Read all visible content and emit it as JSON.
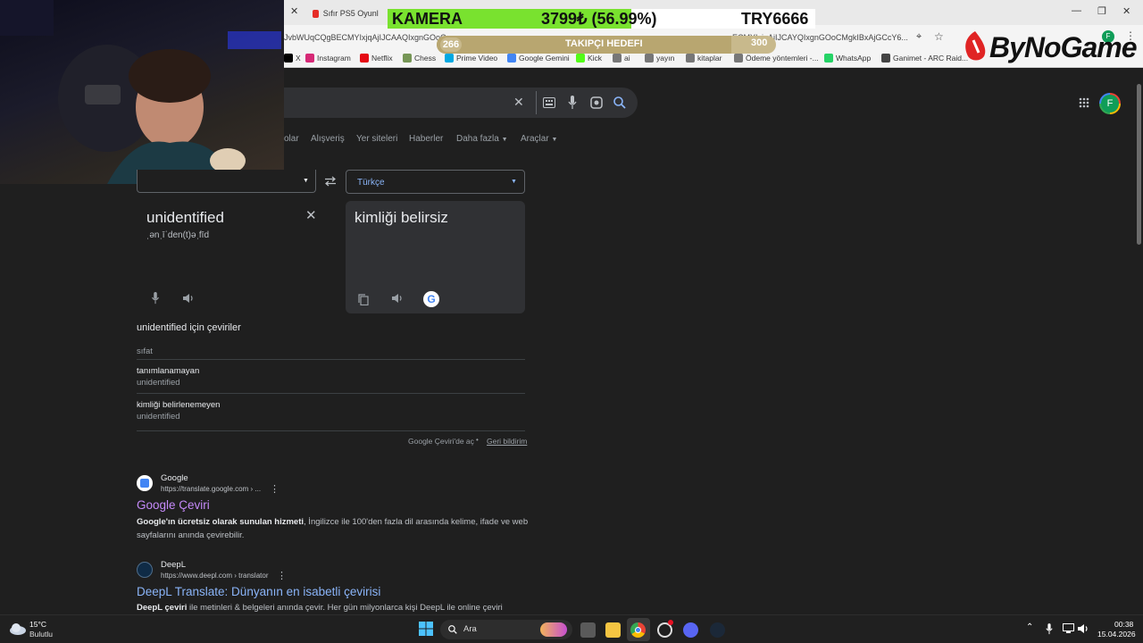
{
  "browser": {
    "tabs": [
      {
        "label": "Sıfır PS5 Oyunlarına"
      }
    ],
    "url_left": "JvbWUqCQgBECMYIxjqAjIJCAAQIxgnGOoC",
    "url_right": "ECMYIxjqAjIJCAYQIxgnGOoCMgkIBxAjGCcY6...",
    "bookmarks": [
      "X",
      "Instagram",
      "Netflix",
      "Chess",
      "Prime Video",
      "Google Gemini",
      "Kick",
      "ai",
      "yayın",
      "kitaplar",
      "Ödeme yöntemleri -...",
      "WhatsApp",
      "Ganimet - ARC Raid..."
    ],
    "bookmark_icon_colors": [
      "#000000",
      "#d62976",
      "#e50914",
      "#769656",
      "#00a8e1",
      "#4285f4",
      "#53fc18",
      "#777777",
      "#777777",
      "#777777",
      "#777777",
      "#25d366",
      "#444444"
    ],
    "profile_initial": "F"
  },
  "overlay": {
    "camera_label": "KAMERA",
    "camera_value": "3799₺ (56.99%)",
    "camera_progress_pct": 56.99,
    "camera_target": "TRY6666",
    "goal_start": "266",
    "goal_label": "TAKIPÇI HEDEFI",
    "goal_end": "300",
    "logo": "ByNoGame"
  },
  "search": {
    "tabs": [
      "olar",
      "Alışveriş",
      "Yer siteleri",
      "Haberler",
      "Daha fazla",
      "Araçlar"
    ]
  },
  "translate": {
    "target_lang": "Türkçe",
    "source_text": "unidentified",
    "phonetic": "ˌənˌīˈden(t)əˌfīd",
    "translated_text": "kimliği belirsiz",
    "translations_heading": "unidentified için çeviriler",
    "pos": "sıfat",
    "entries": [
      {
        "word": "tanımlanamayan",
        "source": "unidentified"
      },
      {
        "word": "kimliği belirlenemeyen",
        "source": "unidentified"
      }
    ],
    "open_link": "Google Çeviri'de aç",
    "feedback": "Geri bildirim"
  },
  "results": [
    {
      "site": "Google",
      "url": "https://translate.google.com › ...",
      "title": "Google Çeviri",
      "snippet_bold": "Google'ın ücretsiz olarak sunulan hizmeti",
      "snippet": ", İngilizce ile 100'den fazla dil arasında kelime, ifade ve web sayfalarını anında çevirebilir."
    },
    {
      "site": "DeepL",
      "url": "https://www.deepl.com › translator",
      "title": "DeepL Translate: Dünyanın en isabetli çevirisi",
      "snippet_bold": "DeepL çeviri",
      "snippet": " ile metinleri & belgeleri anında çevir. Her gün milyonlarca kişi DeepL ile online çeviri"
    }
  ],
  "taskbar": {
    "temp": "15°C",
    "weather": "Bulutlu",
    "search_placeholder": "Ara",
    "time": "00:38",
    "date": "15.04.2026"
  }
}
